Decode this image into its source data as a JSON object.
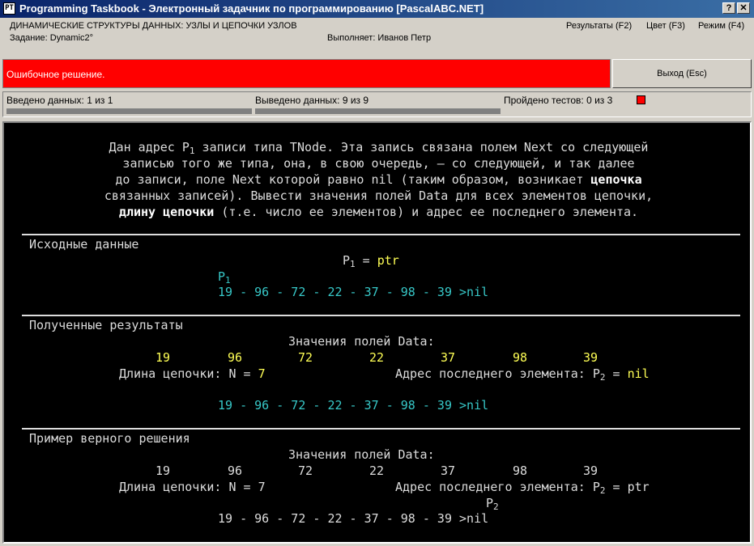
{
  "window": {
    "title": "Programming Taskbook - Электронный задачник по программированию [PascalABC.NET]",
    "help_label": "?",
    "close_label": "✕"
  },
  "header": {
    "topic": "ДИНАМИЧЕСКИЕ СТРУКТУРЫ ДАННЫХ: УЗЛЫ И ЦЕПОЧКИ УЗЛОВ",
    "task": "Задание: Dynamic2°",
    "student": "Выполняет: Иванов Петр",
    "menu": [
      "Результаты (F2)",
      "Цвет (F3)",
      "Режим (F4)"
    ]
  },
  "status": {
    "message": "Ошибочное решение.",
    "exit_label": "Выход (Esc)",
    "input_info": "Введено данных: 1 из 1",
    "output_info": "Выведено данных: 9 из 9",
    "tests_info": "Пройдено тестов: 0 из 3",
    "error_color": "#ff0000"
  },
  "task_text": {
    "l1": "Дан адрес P",
    "l1_sub": "1",
    "l1_rest": " записи типа TNode. Эта запись связана полем Next со следующей",
    "l2": "записью того же типа, она, в свою очередь, — со следующей, и так далее",
    "l3": "до записи, поле Next которой равно nil (таким образом, возникает ",
    "l3_bold": "цепочка",
    "l4": "связанных записей). Вывести значения полей Data для всех элементов цепочки,",
    "l5_bold": "длину цепочки",
    "l5": " (т.е. число ее элементов) и адрес ее последнего элемента."
  },
  "sections": {
    "input_title": "Исходные данные",
    "results_title": "Полученные результаты",
    "example_title": "Пример верного решения"
  },
  "input": {
    "p_label": "P",
    "p_sub": "1",
    "p_eq": " = ",
    "p_value": "ptr",
    "chain_label": "P",
    "chain_sub": "1",
    "chain": "19 - 96 - 72 - 22 - 37 - 98 - 39 >nil"
  },
  "results": {
    "data_caption": "Значения полей Data:",
    "values": [
      "19",
      "96",
      "72",
      "22",
      "37",
      "98",
      "39"
    ],
    "length_label": "Длина цепочки: N = ",
    "length_value": "7",
    "last_label": "Адрес последнего элемента: P",
    "last_sub": "2",
    "last_eq": " = ",
    "last_value": "nil",
    "chain": "19 - 96 - 72 - 22 - 37 - 98 - 39 >nil"
  },
  "example": {
    "data_caption": "Значения полей Data:",
    "values": [
      "19",
      "96",
      "72",
      "22",
      "37",
      "98",
      "39"
    ],
    "length_label": "Длина цепочки: N = ",
    "length_value": "7",
    "last_label": "Адрес последнего элемента: P",
    "last_sub": "2",
    "last_eq": " = ",
    "last_value": "ptr",
    "chain_label": "P",
    "chain_sub": "2",
    "chain": "19 - 96 - 72 - 22 - 37 - 98 - 39 >nil"
  }
}
